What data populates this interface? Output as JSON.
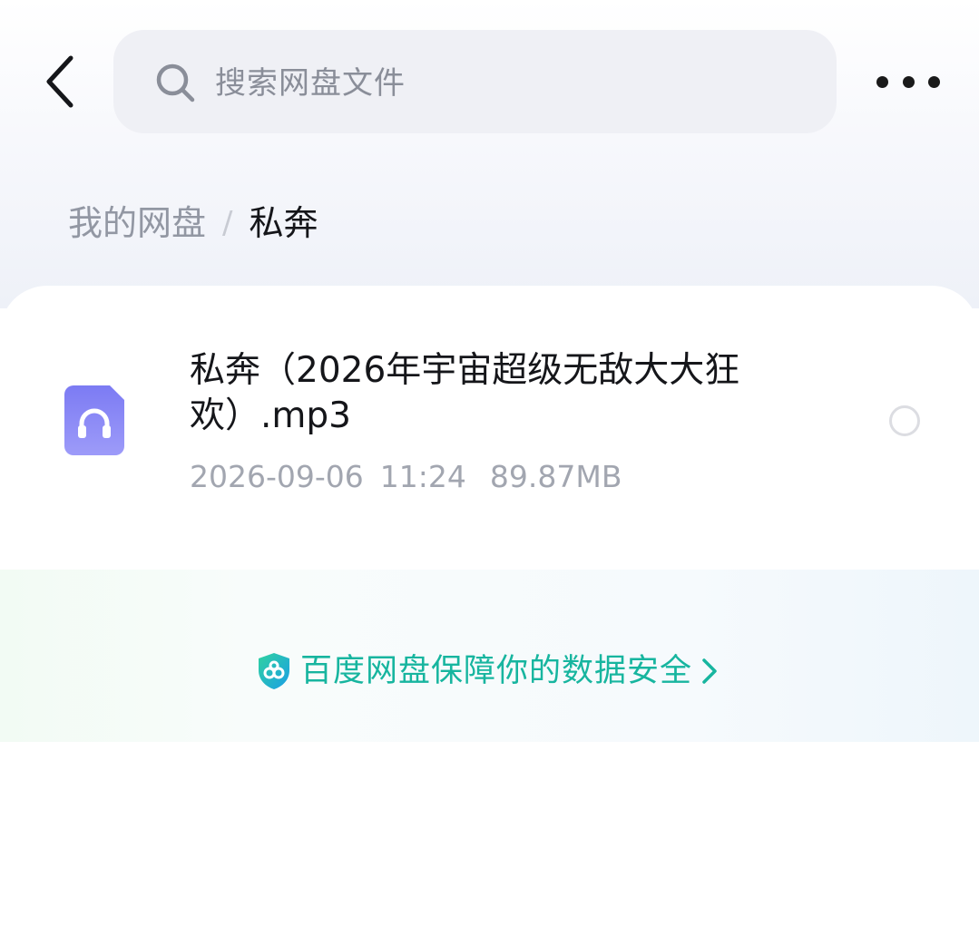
{
  "search": {
    "placeholder": "搜索网盘文件"
  },
  "breadcrumb": {
    "root": "我的网盘",
    "separator": "/",
    "current": "私奔"
  },
  "files": [
    {
      "name": "私奔（2026年宇宙超级无敌大大狂欢）.mp3",
      "date": "2026-09-06",
      "time": "11:24",
      "size": "89.87MB",
      "icon": "audio-file-icon",
      "selected": false
    }
  ],
  "footer": {
    "security_text": "百度网盘保障你的数据安全"
  },
  "icons": {
    "back": "back-arrow-icon",
    "search": "search-icon",
    "more": "more-icon",
    "shield": "shield-icon",
    "chevron": "chevron-right-icon"
  },
  "colors": {
    "accent_green": "#17b59f",
    "audio_icon": "#8f8df6",
    "search_bg": "#eff0f5"
  }
}
